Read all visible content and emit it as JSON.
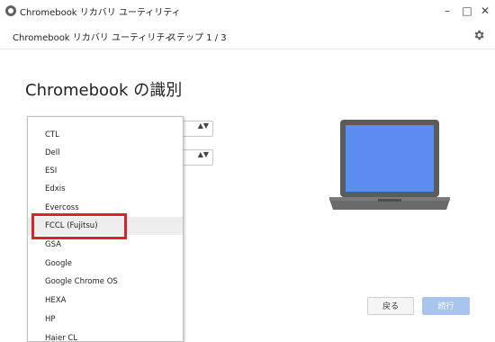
{
  "window": {
    "title": "Chromebook リカバリ ユーティリティ",
    "minimize": "–",
    "maximize": "□",
    "close": "✕"
  },
  "header": {
    "app_name": "Chromebook リカバリ ユーティリティ",
    "separator": "›",
    "step": "ステップ 1 / 3"
  },
  "page": {
    "title": "Chromebook の識別"
  },
  "dropdown": {
    "items": [
      "CTL",
      "Dell",
      "ESI",
      "Edxis",
      "Evercoss",
      "FCCL (Fujitsu)",
      "GSA",
      "Google",
      "Google Chrome OS",
      "HEXA",
      "HP",
      "Haier CL"
    ],
    "highlighted": "FCCL (Fujitsu)"
  },
  "selects": {
    "arrows": "▲▼"
  },
  "buttons": {
    "back": "戻る",
    "next": "続行"
  },
  "colors": {
    "accent_blue": "#a9c5ee",
    "highlight_red": "#d7262b",
    "laptop_screen": "#5b8def"
  }
}
